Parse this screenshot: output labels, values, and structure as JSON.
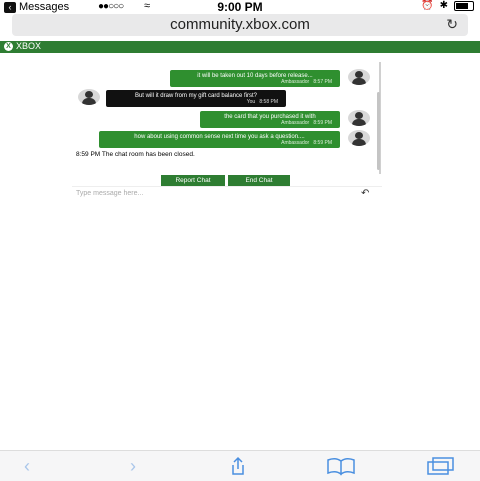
{
  "status": {
    "back_label": "Messages",
    "time": "9:00 PM"
  },
  "browser": {
    "url": "community.xbox.com"
  },
  "brand": {
    "name": "XBOX",
    "color": "#2e7d32"
  },
  "chat": {
    "messages": [
      {
        "text": "it will be taken out 10 days before release...",
        "author": "Ambassador",
        "time": "8:57 PM",
        "side": "right"
      },
      {
        "text": "But will it draw from my gift card balance first?",
        "author": "You",
        "time": "8:58 PM",
        "side": "left"
      },
      {
        "text": "the card that you purchased it with",
        "author": "Ambassador",
        "time": "8:59 PM",
        "side": "right"
      },
      {
        "text": "how about using common sense next time you ask a question....",
        "author": "Ambassador",
        "time": "8:59 PM",
        "side": "right"
      }
    ],
    "closed_notice": "8:59 PM The chat room has been closed.",
    "report_button": "Report Chat",
    "end_button": "End Chat",
    "input_placeholder": "Type message here..."
  },
  "toolbar": {
    "icons": [
      "back-icon",
      "forward-icon",
      "share-icon",
      "bookmarks-icon",
      "tabs-icon"
    ]
  }
}
